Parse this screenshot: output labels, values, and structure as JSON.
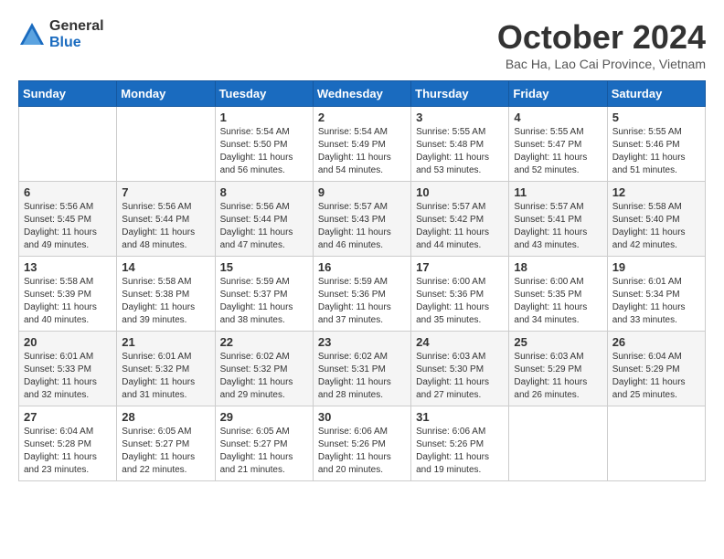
{
  "logo": {
    "general": "General",
    "blue": "Blue"
  },
  "title": "October 2024",
  "subtitle": "Bac Ha, Lao Cai Province, Vietnam",
  "days": [
    "Sunday",
    "Monday",
    "Tuesday",
    "Wednesday",
    "Thursday",
    "Friday",
    "Saturday"
  ],
  "weeks": [
    [
      {
        "day": "",
        "info": ""
      },
      {
        "day": "",
        "info": ""
      },
      {
        "day": "1",
        "info": "Sunrise: 5:54 AM\nSunset: 5:50 PM\nDaylight: 11 hours and 56 minutes."
      },
      {
        "day": "2",
        "info": "Sunrise: 5:54 AM\nSunset: 5:49 PM\nDaylight: 11 hours and 54 minutes."
      },
      {
        "day": "3",
        "info": "Sunrise: 5:55 AM\nSunset: 5:48 PM\nDaylight: 11 hours and 53 minutes."
      },
      {
        "day": "4",
        "info": "Sunrise: 5:55 AM\nSunset: 5:47 PM\nDaylight: 11 hours and 52 minutes."
      },
      {
        "day": "5",
        "info": "Sunrise: 5:55 AM\nSunset: 5:46 PM\nDaylight: 11 hours and 51 minutes."
      }
    ],
    [
      {
        "day": "6",
        "info": "Sunrise: 5:56 AM\nSunset: 5:45 PM\nDaylight: 11 hours and 49 minutes."
      },
      {
        "day": "7",
        "info": "Sunrise: 5:56 AM\nSunset: 5:44 PM\nDaylight: 11 hours and 48 minutes."
      },
      {
        "day": "8",
        "info": "Sunrise: 5:56 AM\nSunset: 5:44 PM\nDaylight: 11 hours and 47 minutes."
      },
      {
        "day": "9",
        "info": "Sunrise: 5:57 AM\nSunset: 5:43 PM\nDaylight: 11 hours and 46 minutes."
      },
      {
        "day": "10",
        "info": "Sunrise: 5:57 AM\nSunset: 5:42 PM\nDaylight: 11 hours and 44 minutes."
      },
      {
        "day": "11",
        "info": "Sunrise: 5:57 AM\nSunset: 5:41 PM\nDaylight: 11 hours and 43 minutes."
      },
      {
        "day": "12",
        "info": "Sunrise: 5:58 AM\nSunset: 5:40 PM\nDaylight: 11 hours and 42 minutes."
      }
    ],
    [
      {
        "day": "13",
        "info": "Sunrise: 5:58 AM\nSunset: 5:39 PM\nDaylight: 11 hours and 40 minutes."
      },
      {
        "day": "14",
        "info": "Sunrise: 5:58 AM\nSunset: 5:38 PM\nDaylight: 11 hours and 39 minutes."
      },
      {
        "day": "15",
        "info": "Sunrise: 5:59 AM\nSunset: 5:37 PM\nDaylight: 11 hours and 38 minutes."
      },
      {
        "day": "16",
        "info": "Sunrise: 5:59 AM\nSunset: 5:36 PM\nDaylight: 11 hours and 37 minutes."
      },
      {
        "day": "17",
        "info": "Sunrise: 6:00 AM\nSunset: 5:36 PM\nDaylight: 11 hours and 35 minutes."
      },
      {
        "day": "18",
        "info": "Sunrise: 6:00 AM\nSunset: 5:35 PM\nDaylight: 11 hours and 34 minutes."
      },
      {
        "day": "19",
        "info": "Sunrise: 6:01 AM\nSunset: 5:34 PM\nDaylight: 11 hours and 33 minutes."
      }
    ],
    [
      {
        "day": "20",
        "info": "Sunrise: 6:01 AM\nSunset: 5:33 PM\nDaylight: 11 hours and 32 minutes."
      },
      {
        "day": "21",
        "info": "Sunrise: 6:01 AM\nSunset: 5:32 PM\nDaylight: 11 hours and 31 minutes."
      },
      {
        "day": "22",
        "info": "Sunrise: 6:02 AM\nSunset: 5:32 PM\nDaylight: 11 hours and 29 minutes."
      },
      {
        "day": "23",
        "info": "Sunrise: 6:02 AM\nSunset: 5:31 PM\nDaylight: 11 hours and 28 minutes."
      },
      {
        "day": "24",
        "info": "Sunrise: 6:03 AM\nSunset: 5:30 PM\nDaylight: 11 hours and 27 minutes."
      },
      {
        "day": "25",
        "info": "Sunrise: 6:03 AM\nSunset: 5:29 PM\nDaylight: 11 hours and 26 minutes."
      },
      {
        "day": "26",
        "info": "Sunrise: 6:04 AM\nSunset: 5:29 PM\nDaylight: 11 hours and 25 minutes."
      }
    ],
    [
      {
        "day": "27",
        "info": "Sunrise: 6:04 AM\nSunset: 5:28 PM\nDaylight: 11 hours and 23 minutes."
      },
      {
        "day": "28",
        "info": "Sunrise: 6:05 AM\nSunset: 5:27 PM\nDaylight: 11 hours and 22 minutes."
      },
      {
        "day": "29",
        "info": "Sunrise: 6:05 AM\nSunset: 5:27 PM\nDaylight: 11 hours and 21 minutes."
      },
      {
        "day": "30",
        "info": "Sunrise: 6:06 AM\nSunset: 5:26 PM\nDaylight: 11 hours and 20 minutes."
      },
      {
        "day": "31",
        "info": "Sunrise: 6:06 AM\nSunset: 5:26 PM\nDaylight: 11 hours and 19 minutes."
      },
      {
        "day": "",
        "info": ""
      },
      {
        "day": "",
        "info": ""
      }
    ]
  ]
}
